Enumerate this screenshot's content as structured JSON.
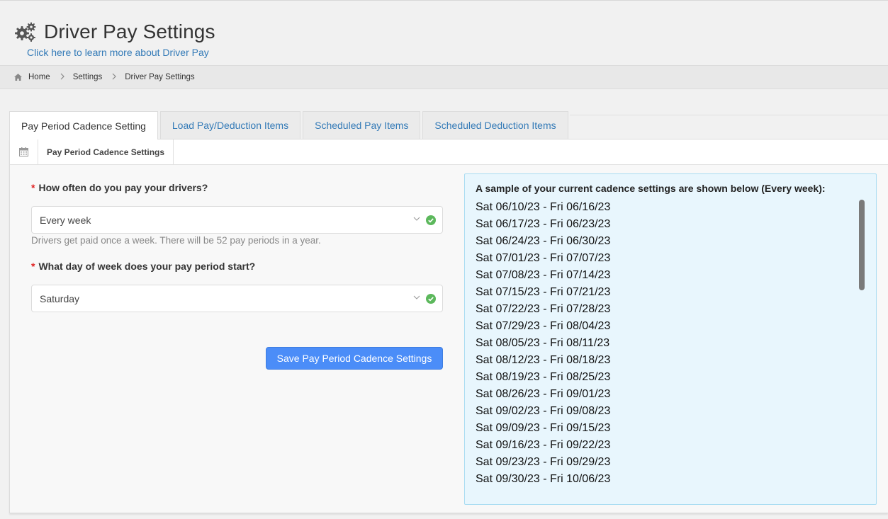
{
  "header": {
    "title": "Driver Pay Settings",
    "learn_more": "Click here to learn more about Driver Pay"
  },
  "breadcrumb": {
    "home": "Home",
    "settings": "Settings",
    "current": "Driver Pay Settings"
  },
  "tabs": [
    {
      "label": "Pay Period Cadence Setting"
    },
    {
      "label": "Load Pay/Deduction Items"
    },
    {
      "label": "Scheduled Pay Items"
    },
    {
      "label": "Scheduled Deduction Items"
    }
  ],
  "portlet": {
    "title": "Pay Period Cadence Settings"
  },
  "form": {
    "required_mark": "*",
    "frequency_label": "How often do you pay your drivers?",
    "frequency_value": "Every week",
    "frequency_help": "Drivers get paid once a week. There will be 52 pay periods in a year.",
    "start_day_label": "What day of week does your pay period start?",
    "start_day_value": "Saturday",
    "save_label": "Save Pay Period Cadence Settings"
  },
  "sample": {
    "title": "A sample of your current cadence settings are shown below (Every week):",
    "periods": [
      "Sat 06/10/23 - Fri 06/16/23",
      "Sat 06/17/23 - Fri 06/23/23",
      "Sat 06/24/23 - Fri 06/30/23",
      "Sat 07/01/23 - Fri 07/07/23",
      "Sat 07/08/23 - Fri 07/14/23",
      "Sat 07/15/23 - Fri 07/21/23",
      "Sat 07/22/23 - Fri 07/28/23",
      "Sat 07/29/23 - Fri 08/04/23",
      "Sat 08/05/23 - Fri 08/11/23",
      "Sat 08/12/23 - Fri 08/18/23",
      "Sat 08/19/23 - Fri 08/25/23",
      "Sat 08/26/23 - Fri 09/01/23",
      "Sat 09/02/23 - Fri 09/08/23",
      "Sat 09/09/23 - Fri 09/15/23",
      "Sat 09/16/23 - Fri 09/22/23",
      "Sat 09/23/23 - Fri 09/29/23",
      "Sat 09/30/23 - Fri 10/06/23"
    ]
  },
  "colors": {
    "link": "#337ab7",
    "primary_button": "#4b8df8",
    "required": "#e02222",
    "valid": "#5cb85c",
    "sample_bg": "#e8f6fd"
  }
}
